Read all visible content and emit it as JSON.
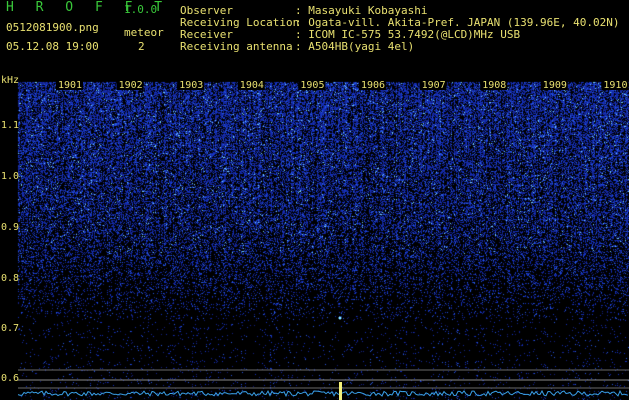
{
  "header": {
    "program_name": "H R O F F T",
    "version": "1.0.0",
    "filename": "0512081900.png",
    "datetime": "05.12.08 19:00",
    "meteor_label": "meteor",
    "meteor_count": "2"
  },
  "info": [
    {
      "label": "Observer",
      "value": ": Masayuki Kobayashi"
    },
    {
      "label": "Receiving Location",
      "value": ": Ogata-vill. Akita-Pref. JAPAN (139.96E, 40.02N)"
    },
    {
      "label": "Receiver",
      "value": ": ICOM IC-575 53.7492(@LCD)MHz USB"
    },
    {
      "label": "Receiving antenna",
      "value": ": A504HB(yagi 4el)"
    }
  ],
  "spectrogram": {
    "unit_label": "kHz",
    "time_labels": [
      "1901",
      "1902",
      "1903",
      "1904",
      "1905",
      "1906",
      "1907",
      "1908",
      "1909",
      "1910"
    ],
    "freq_labels": [
      "1.1",
      "1.0",
      "0.9",
      "0.8",
      "0.7",
      "0.6"
    ],
    "colors": {
      "background": "#000000",
      "noise": "#2a3cd8",
      "bright": "#7ad6ff",
      "axis_text": "#e8e070",
      "header_green": "#39c83a",
      "marker": "#f4f07a"
    }
  }
}
